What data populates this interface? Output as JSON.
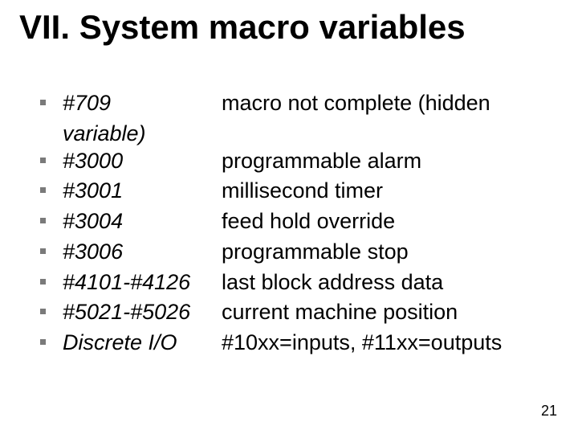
{
  "slide": {
    "title": "VII. System macro variables",
    "page_number": "21",
    "items": [
      {
        "var": "#709",
        "wrap": "variable)",
        "desc": "macro not complete (hidden"
      },
      {
        "var": "#3000",
        "desc": "programmable alarm"
      },
      {
        "var": "#3001",
        "desc": "millisecond timer"
      },
      {
        "var": "#3004",
        "desc": "feed hold override"
      },
      {
        "var": "#3006",
        "desc": "programmable stop"
      },
      {
        "var": "#4101-#4126",
        "desc": "last block address data"
      },
      {
        "var": "#5021-#5026",
        "desc": "current machine position"
      },
      {
        "var": "Discrete I/O",
        "desc": "#10xx=inputs, #11xx=outputs"
      }
    ]
  }
}
